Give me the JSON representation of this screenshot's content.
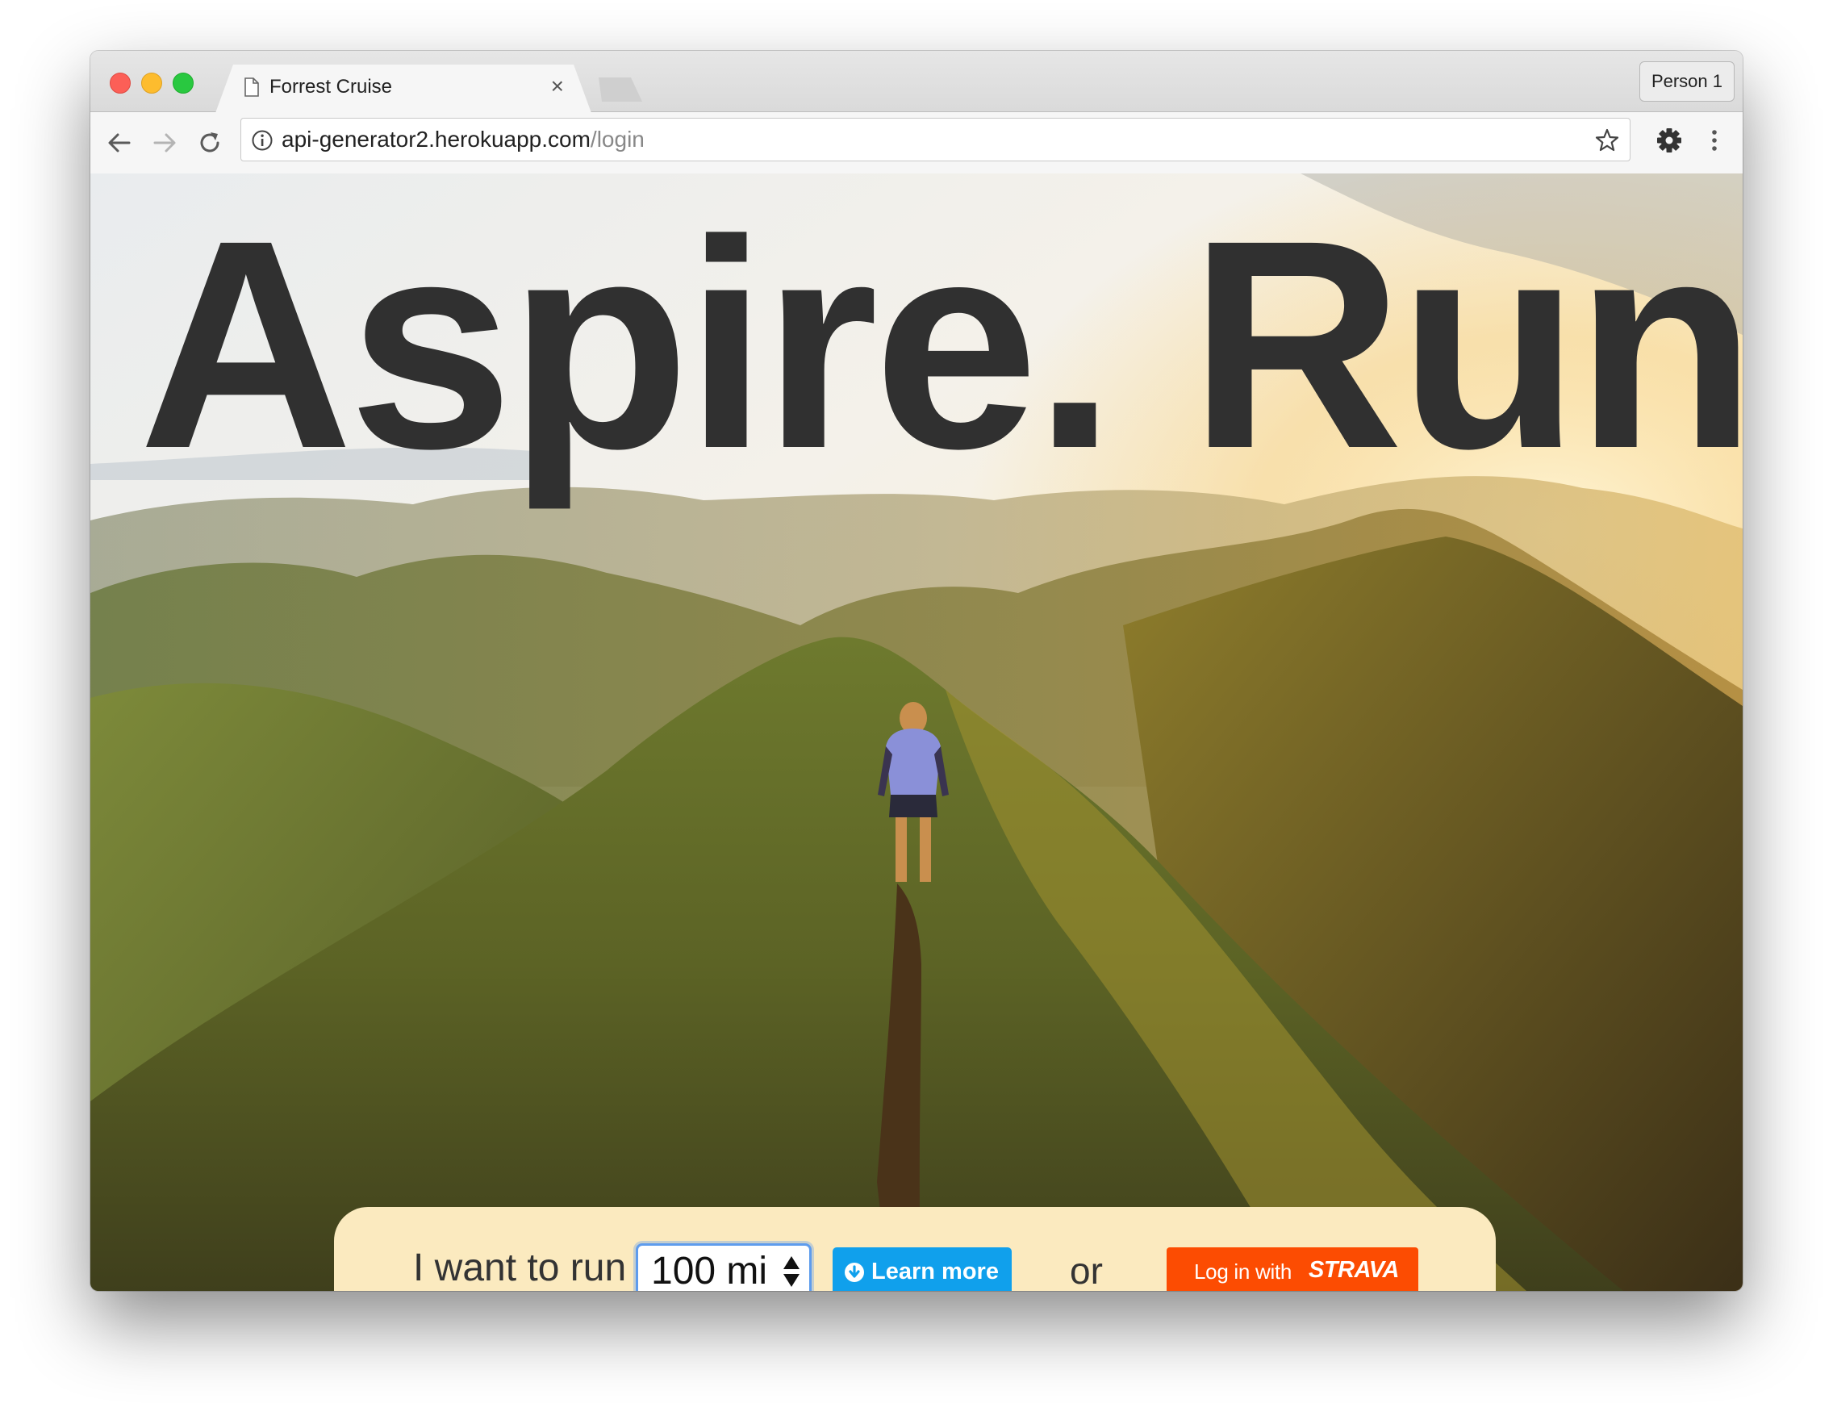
{
  "browser": {
    "tab": {
      "title": "Forrest Cruise",
      "close_glyph": "×"
    },
    "profile": "Person 1",
    "url": {
      "host": "api-generator2.herokuapp.com",
      "path": "/login"
    },
    "icons": [
      "back-arrow-icon",
      "forward-arrow-icon",
      "reload-icon",
      "info-icon",
      "star-icon",
      "gear-icon",
      "menu-dots-icon"
    ]
  },
  "page": {
    "headline": "Aspire. Run.",
    "prompt": "I want to run",
    "goal_select": {
      "value": "100 mi"
    },
    "learn_more": {
      "label": "Learn more",
      "icon": "arrow-circle-down-icon"
    },
    "separator": "or",
    "strava_button": {
      "prefix": "Log in with",
      "brand": "STRAVA"
    }
  },
  "colors": {
    "headline": "#303030",
    "panel": "#fbeabf",
    "learn_more": "#10a0ec",
    "strava": "#fc4c02"
  }
}
